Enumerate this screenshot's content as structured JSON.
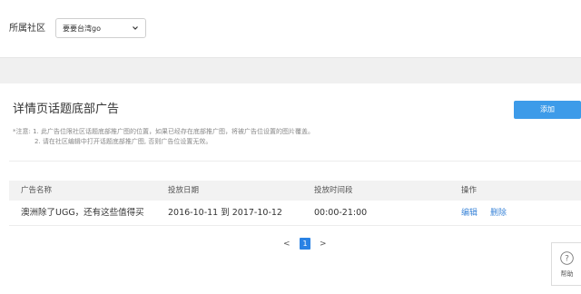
{
  "filter": {
    "community_label": "所属社区",
    "community_value": "要要台湾go"
  },
  "section": {
    "title": "详情页话题底部广告",
    "add_label": "添加",
    "note_line1": "*注意: 1. 此广告位限社区话题底部推广图的位置，如果已经存在底部推广图，将被广告位设置的图片覆盖。",
    "note_line2": "2. 请在社区编辑中打开话题底部推广图, 否则广告位设置无效。"
  },
  "table": {
    "headers": [
      "广告名称",
      "投放日期",
      "投放时间段",
      "操作"
    ],
    "rows": [
      {
        "name": "澳洲除了UGG，还有这些值得买",
        "dates": "2016-10-11 到 2017-10-12",
        "time": "00:00-21:00",
        "edit": "编辑",
        "delete": "删除"
      }
    ]
  },
  "pagination": {
    "prev": "<",
    "current": "1",
    "next": ">"
  },
  "help": {
    "icon_glyph": "?",
    "label": "帮助"
  }
}
